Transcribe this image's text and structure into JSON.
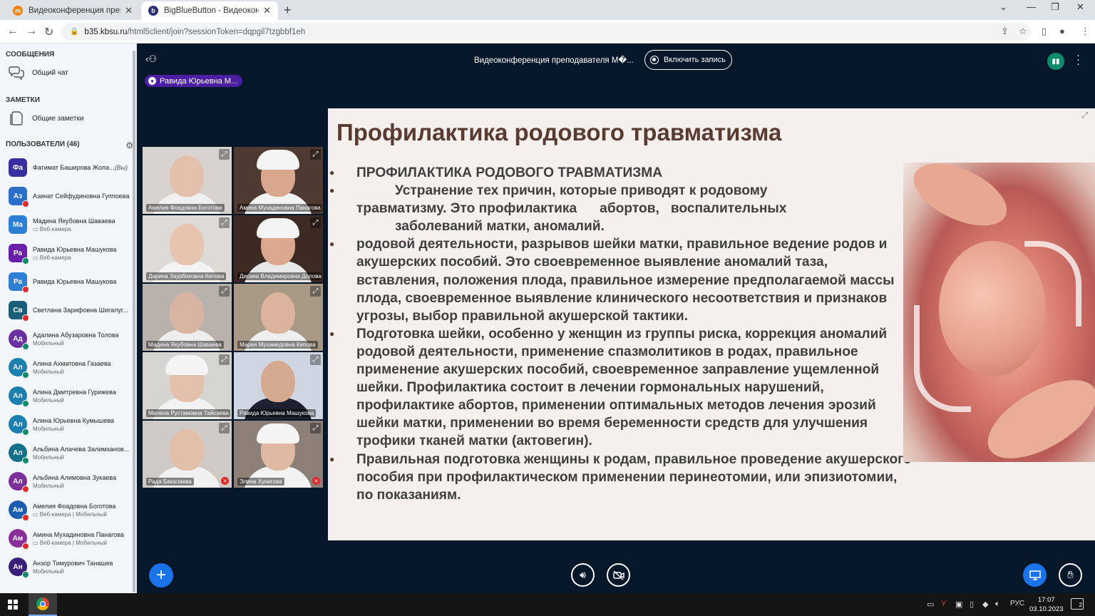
{
  "browser": {
    "tabs": [
      {
        "title": "Видеоконференция преподава",
        "active": false
      },
      {
        "title": "BigBlueButton - Видеоконфере",
        "active": true
      }
    ],
    "url_host": "b35.kbsu.ru",
    "url_path": "/html5client/join?sessionToken=dqpgil7tzgbbf1eh"
  },
  "sidebar": {
    "messages_heading": "СООБЩЕНИЯ",
    "public_chat": "Общий чат",
    "notes_heading": "ЗАМЕТКИ",
    "shared_notes": "Общие заметки",
    "users_heading": "ПОЛЬЗОВАТЕЛИ (46)",
    "users": [
      {
        "initials": "Фа",
        "name": "Фатимат Баширова Жола...",
        "you": "(Вы)",
        "sub": "",
        "color": "#3a2fa0",
        "dot": "",
        "shape": "square"
      },
      {
        "initials": "Аз",
        "name": "Азинат Сейфудиновна Гуппоева",
        "sub": "",
        "color": "#2c6fc9",
        "dot": "#e02b2b",
        "shape": "square"
      },
      {
        "initials": "Ма",
        "name": "Мадина Якубовна Шаваева",
        "sub": "Веб-камера",
        "color": "#2d7fd6",
        "dot": "",
        "shape": "square"
      },
      {
        "initials": "Ра",
        "name": "Равида Юрьевна Машукова",
        "sub": "Веб-камера",
        "color": "#6a1fa8",
        "dot": "#0f8a6b",
        "shape": "square"
      },
      {
        "initials": "Ра",
        "name": "Равида Юрьевна Машукова",
        "sub": "",
        "color": "#2d7fd6",
        "dot": "#e02b2b",
        "shape": "square"
      },
      {
        "initials": "Св",
        "name": "Светлана Зарифовна Шигалуг...",
        "sub": "",
        "color": "#1b5c7a",
        "dot": "#e02b2b",
        "shape": "square"
      },
      {
        "initials": "Ад",
        "name": "Адалина Абузаровна Толова",
        "sub": "Мобильный",
        "color": "#6a2fa0",
        "dot": "#0f8a6b",
        "shape": "round"
      },
      {
        "initials": "Ал",
        "name": "Алина Ахматовна Газаева",
        "sub": "Мобильный",
        "color": "#1b7fb0",
        "dot": "#0f8a6b",
        "shape": "round"
      },
      {
        "initials": "Ал",
        "name": "Алина Дмитревна Гурижева",
        "sub": "Мобильный",
        "color": "#1b7fb0",
        "dot": "#0f8a6b",
        "shape": "round"
      },
      {
        "initials": "Ал",
        "name": "Алина Юрьевна Кумышева",
        "sub": "Мобильный",
        "color": "#1b7fb0",
        "dot": "#0f8a6b",
        "shape": "round"
      },
      {
        "initials": "Ал",
        "name": "Альбина Алачева Залимханов...",
        "sub": "Мобильный",
        "color": "#13708a",
        "dot": "#0f8a6b",
        "shape": "round"
      },
      {
        "initials": "Ал",
        "name": "Альбина Алимовна Зукаева",
        "sub": "Мобильный",
        "color": "#7a2f9a",
        "dot": "#e02b2b",
        "shape": "round"
      },
      {
        "initials": "Ам",
        "name": "Амелия Фоадовна Боготова",
        "sub": "Веб-камера | Мобильный",
        "color": "#1b5cb0",
        "dot": "#e02b2b",
        "shape": "round"
      },
      {
        "initials": "Ам",
        "name": "Амина Мухадиновна Панагова",
        "sub": "Веб-камера | Мобильный",
        "color": "#8a2f9a",
        "dot": "#e02b2b",
        "shape": "round"
      },
      {
        "initials": "Ан",
        "name": "Анзор Тимурович Танашев",
        "sub": "Мобильный",
        "color": "#3a1f7a",
        "dot": "#0f8a6b",
        "shape": "round"
      }
    ]
  },
  "topbar": {
    "title": "Видеоконференция преподавателя М�...",
    "record_label": "Включить запись",
    "talker": "Равида Юрьевна М..."
  },
  "videos": [
    {
      "name": "Амелия Фоадовна Боготова",
      "bg": "#d9d3cf",
      "skin": "#e3c0ac",
      "body": "#f0f0f0",
      "hat": false,
      "muted": false
    },
    {
      "name": "Амина Мухадиновна Панагова",
      "bg": "#4e3a30",
      "skin": "#d9a78d",
      "body": "#f2f2f2",
      "hat": true,
      "muted": false
    },
    {
      "name": "Дарина Заурбековна Кипова",
      "bg": "#dedad6",
      "skin": "#e6c4b0",
      "body": "#f3f3f3",
      "hat": false,
      "muted": false
    },
    {
      "name": "Дисана Владимировна Долова",
      "bg": "#3d2a22",
      "skin": "#d9a88f",
      "body": "#e8e8e8",
      "hat": true,
      "muted": false
    },
    {
      "name": "Мадина Якубовна Шаваева",
      "bg": "#b9b2ac",
      "skin": "#d8b4a2",
      "body": "#eeeeee",
      "hat": false,
      "muted": false
    },
    {
      "name": "Мария Мухамедовна Кипова",
      "bg": "#a89886",
      "skin": "#dcb39c",
      "body": "#efefef",
      "hat": false,
      "muted": false
    },
    {
      "name": "Милена Рустамовна Тайсаева",
      "bg": "#d7d5d2",
      "skin": "#e2c0ab",
      "body": "#f2f2f2",
      "hat": true,
      "muted": false
    },
    {
      "name": "Равида Юрьевна Машукова",
      "bg": "#cfd6e2",
      "skin": "#d4a98f",
      "body": "#1e2230",
      "hat": false,
      "muted": false
    },
    {
      "name": "Рада Бакалаева",
      "bg": "#cfcac6",
      "skin": "#e1bfa9",
      "body": "#f1f1f1",
      "hat": false,
      "muted": true
    },
    {
      "name": "Элина Хунигова",
      "bg": "#8c7f78",
      "skin": "#dfb9a3",
      "body": "#f2f2f2",
      "hat": true,
      "muted": true
    }
  ],
  "slide": {
    "title": "Профилактика родового травматизма",
    "b1": "ПРОФИЛАКТИКА РОДОВОГО ТРАВМАТИЗМА",
    "b2_l1": "Устранение тех причин, которые приводят к родовому",
    "b2_l2": "травматизму. Это профилактика      абортов,   воспалительных",
    "b2_l3": "заболеваний матки, аномалий.",
    "b3": "родовой деятельности, разрывов шейки матки, правильное ведение родов и акушерских пособий. Это своевременное выявление аномалий таза, вставления, положения плода, правильное измерение предполагаемой массы плода, своевременное выявление клинического несоответствия и признаков угрозы, выбор правильной акушерской тактики.",
    "b4": "Подготовка шейки, особенно у женщин из группы риска, коррекция аномалий родовой деятельности, применение спазмолитиков в родах, правильное применение акушерских пособий, своевременное заправление ущемленной шейки. Профилактика состоит в лечении гормональных нарушений, профилактике абортов, применении оптимальных методов лечения эрозий шейки матки, применении во время беременности средств для улучшения трофики тканей матки (актовегин).",
    "b5": "Правильная подготовка женщины к родам, правильное проведение акушерского пособия при профилактическом применении перинеотомии, или эпизиотомии, по показаниям."
  },
  "taskbar": {
    "lang": "РУС",
    "time": "17:07",
    "date": "03.10.2023",
    "notifications": "2"
  }
}
